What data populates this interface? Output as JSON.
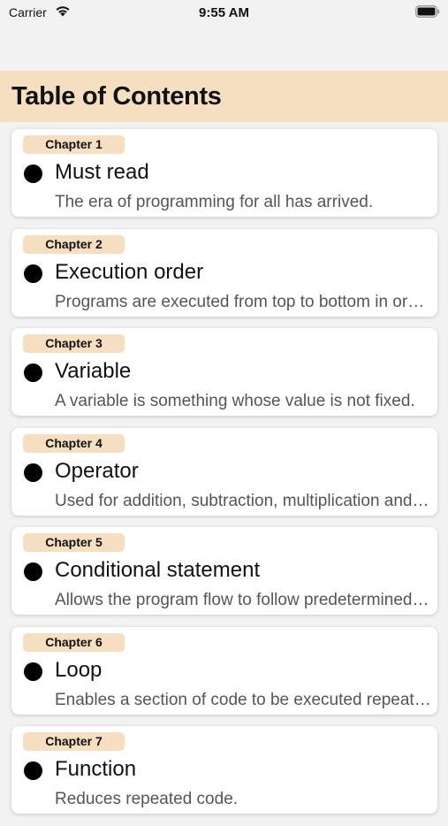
{
  "status_bar": {
    "carrier": "Carrier",
    "time": "9:55 AM"
  },
  "header": {
    "title": "Table of Contents"
  },
  "colors": {
    "accent": "#f5dfc0",
    "background": "#f2f2f2",
    "card": "#ffffff"
  },
  "chapters": [
    {
      "badge": "Chapter 1",
      "title": "Must read",
      "description": "The era of programming for all has arrived."
    },
    {
      "badge": "Chapter 2",
      "title": "Execution order",
      "description": "Programs are executed from top to bottom in order."
    },
    {
      "badge": "Chapter 3",
      "title": "Variable",
      "description": "A variable is something whose value is not fixed."
    },
    {
      "badge": "Chapter 4",
      "title": "Operator",
      "description": "Used for addition, subtraction, multiplication and division."
    },
    {
      "badge": "Chapter 5",
      "title": "Conditional statement",
      "description": "Allows the program flow to follow predetermined conditions."
    },
    {
      "badge": "Chapter 6",
      "title": "Loop",
      "description": "Enables a section of code to be executed repeatedly."
    },
    {
      "badge": "Chapter 7",
      "title": "Function",
      "description": "Reduces repeated code."
    }
  ]
}
